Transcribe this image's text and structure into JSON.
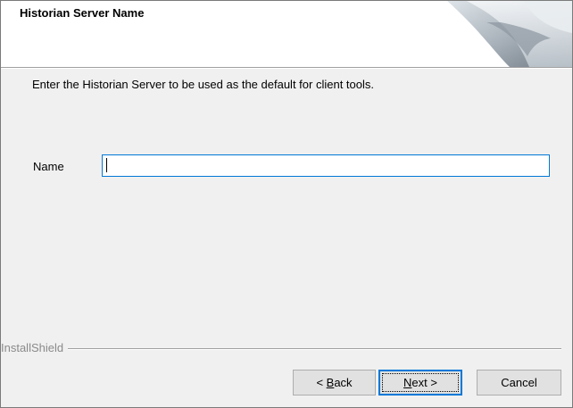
{
  "header": {
    "title": "Historian Server Name"
  },
  "body": {
    "instruction": "Enter the Historian Server to be used as the default for client tools.",
    "name_label": "Name",
    "name_value": ""
  },
  "footer": {
    "brand": "InstallShield",
    "back": {
      "prefix": "< ",
      "mnemonic": "B",
      "rest": "ack"
    },
    "next": {
      "prefix": "",
      "mnemonic": "N",
      "rest": "ext >"
    },
    "cancel": "Cancel"
  },
  "colors": {
    "focus_blue": "#0078d7",
    "panel": "#f0f0f0",
    "header_bg": "#ffffff"
  }
}
